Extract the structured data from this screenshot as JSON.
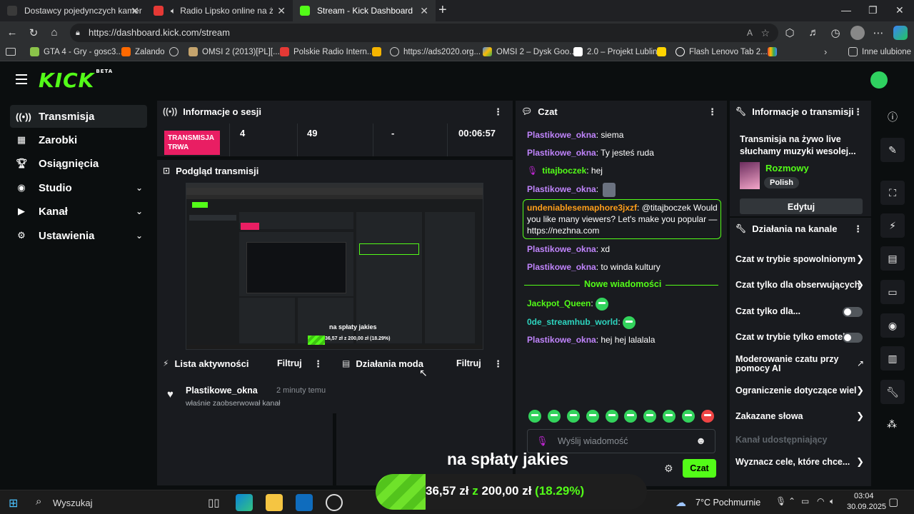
{
  "browser": {
    "tabs": [
      {
        "label": "Dostawcy pojedynczych kamer"
      },
      {
        "label": "Radio Lipsko online na żywo"
      },
      {
        "label": "Stream - Kick Dashboard"
      }
    ],
    "new_tab": "+",
    "url": "https://dashboard.kick.com/stream",
    "favorites": [
      "GTA 4 - Gry - gosc3...",
      "Zalando",
      "OMSI 2 (2013)[PL][...",
      "Polskie Radio Intern...",
      "https://ads2020.org...",
      "OMSI 2 – Dysk Goo...",
      "2.0 – Projekt Lublin",
      "Flash Lenovo Tab 2...",
      "Inne ulubione"
    ]
  },
  "brand": {
    "logo": "KICK",
    "beta": "BETA"
  },
  "sidebar": {
    "items": [
      {
        "label": "Transmisja"
      },
      {
        "label": "Zarobki"
      },
      {
        "label": "Osiągnięcia"
      },
      {
        "label": "Studio"
      },
      {
        "label": "Kanał"
      },
      {
        "label": "Ustawienia"
      }
    ]
  },
  "session": {
    "title": "Informacje o sesji",
    "live_badge": "TRANSMISJA TRWA",
    "stat1": "4",
    "stat2": "49",
    "stat3": "-",
    "stat4": "00:06:57"
  },
  "preview": {
    "title": "Podgląd transmisji",
    "overlay_text": "na spłaty jakies",
    "overlay_amount": "36,57 zł z 200,00 zł (18.29%)"
  },
  "activity": {
    "title": "Lista aktywności",
    "filter": "Filtruj",
    "user": "Plastikowe_okna",
    "time": "2 minuty temu",
    "text": "właśnie zaobserwował kanał"
  },
  "mod_actions": {
    "title": "Działania moda",
    "filter": "Filtruj"
  },
  "chat": {
    "title": "Czat",
    "messages": [
      {
        "user": "Plastikowe_okna",
        "text": ": siema"
      },
      {
        "user": "Plastikowe_okna",
        "text": ": Ty jesteś ruda"
      },
      {
        "user": "titajboczek",
        "text": ": hej"
      },
      {
        "user": "Plastikowe_okna",
        "text": ":"
      },
      {
        "user": "undeniablesemaphore3jxzf",
        "text": ": @titajboczek Would you like many viewers? Let's make you popular — https://nezhna.com"
      },
      {
        "user": "Plastikowe_okna",
        "text": ": xd"
      },
      {
        "user": "Plastikowe_okna",
        "text": ": to winda kultury"
      },
      {
        "user": "Jackpot_Queen",
        "text": ":"
      },
      {
        "user": "0de_streamhub_world",
        "text": ":"
      },
      {
        "user": "Plastikowe_okna",
        "text": ": hej hej lalalala"
      }
    ],
    "new_messages": "Nowe wiadomości",
    "input_placeholder": "Wyślij wiadomość",
    "send": "Czat"
  },
  "stream_info": {
    "title": "Informacje o transmisji",
    "stream_title": "Transmisja na żywo live słuchamy muzyki wesolej...",
    "category": "Rozmowy",
    "language": "Polish",
    "edit": "Edytuj"
  },
  "channel_actions": {
    "title": "Działania na kanale",
    "rows": [
      {
        "label": "Czat w trybie spowolnionym"
      },
      {
        "label": "Czat tylko dla obserwujących"
      },
      {
        "label": "Czat tylko dla..."
      },
      {
        "label": "Czat w trybie tylko emotek"
      },
      {
        "label": "Moderowanie czatu przy pomocy AI"
      },
      {
        "label": "Ograniczenie dotyczące wiel"
      },
      {
        "label": "Zakazane słowa"
      },
      {
        "label": "Kanał udostępniający"
      },
      {
        "label": "Wyznacz cele, które chce..."
      }
    ]
  },
  "overlay": {
    "text": "na spłaty jakies",
    "current": "36,57 zł",
    "of": "z",
    "goal": "200,00 zł",
    "percent": "(18.29%)",
    "progress": 0.1829
  },
  "taskbar": {
    "search": "Wyszukaj",
    "weather": "7°C Pochmurnie",
    "time": "03:04",
    "date": "30.09.2025"
  },
  "colors": {
    "kick_green": "#53fc18",
    "username_purple": "#c084fc",
    "username_orange": "#ff9f1a",
    "live_red": "#e91e63"
  }
}
